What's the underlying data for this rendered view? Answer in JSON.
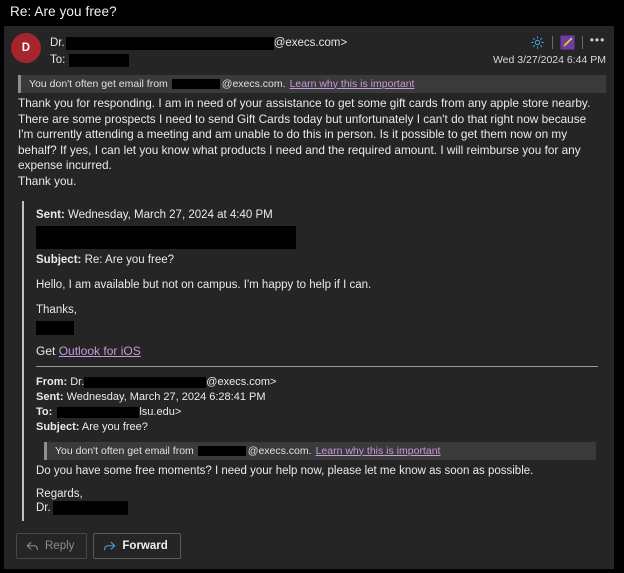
{
  "subject_bar": {
    "title": "Re: Are you free?"
  },
  "header": {
    "avatar_initial": "D",
    "from_prefix": "Dr.",
    "from_domain": "@execs.com>",
    "to_label": "To:",
    "timestamp": "Wed 3/27/2024 6:44 PM",
    "icons": {
      "brightness": "sun-icon",
      "highlighter": "highlighter-icon",
      "more": "more-options-icon"
    }
  },
  "warning_banner": {
    "text_before": "You don't often get email from",
    "text_after": "@execs.com.",
    "link": "Learn why this is important"
  },
  "body": {
    "paragraph": "Thank you for responding. I am in need of your assistance to get some gift cards from any apple store nearby. There are some prospects I need to send Gift Cards today but unfortunately I can't do that right now because I'm currently attending a meeting and am unable to do this in person. Is it possible to get them now on my behalf? If yes, I can let you know what products I need and the required amount. I will reimburse you for any expense incurred.",
    "closing": "Thank you."
  },
  "quoted": {
    "sent_label": "Sent:",
    "sent_value": "Wednesday, March 27, 2024 at 4:40 PM",
    "subject_label": "Subject:",
    "subject_value": "Re: Are you free?",
    "message": "Hello, I am available but not on campus. I'm happy to help if I can.",
    "signoff": "Thanks,",
    "get_prefix": "Get",
    "get_link": "Outlook for iOS"
  },
  "inner_quoted": {
    "from_label": "From:",
    "from_prefix": "Dr.",
    "from_domain": "@execs.com>",
    "sent_label": "Sent:",
    "sent_value": "Wednesday, March 27, 2024 6:28:41 PM",
    "to_label": "To:",
    "to_domain": "lsu.edu>",
    "subject_label": "Subject:",
    "subject_value": "Are you free?",
    "message": "Do you have some free moments? I need your help now, please let me know as soon as possible.",
    "signoff": "Regards,",
    "signoff_name_prefix": "Dr."
  },
  "footer": {
    "reply_label": "Reply",
    "forward_label": "Forward"
  },
  "colors": {
    "page_bg": "#000000",
    "card_bg": "#252525",
    "banner_bg": "#3a3a3a",
    "avatar_bg": "#a4262c",
    "link": "#c69bdc",
    "accent_blue": "#4aa3e0",
    "quote_bar": "#c2c2c2"
  }
}
